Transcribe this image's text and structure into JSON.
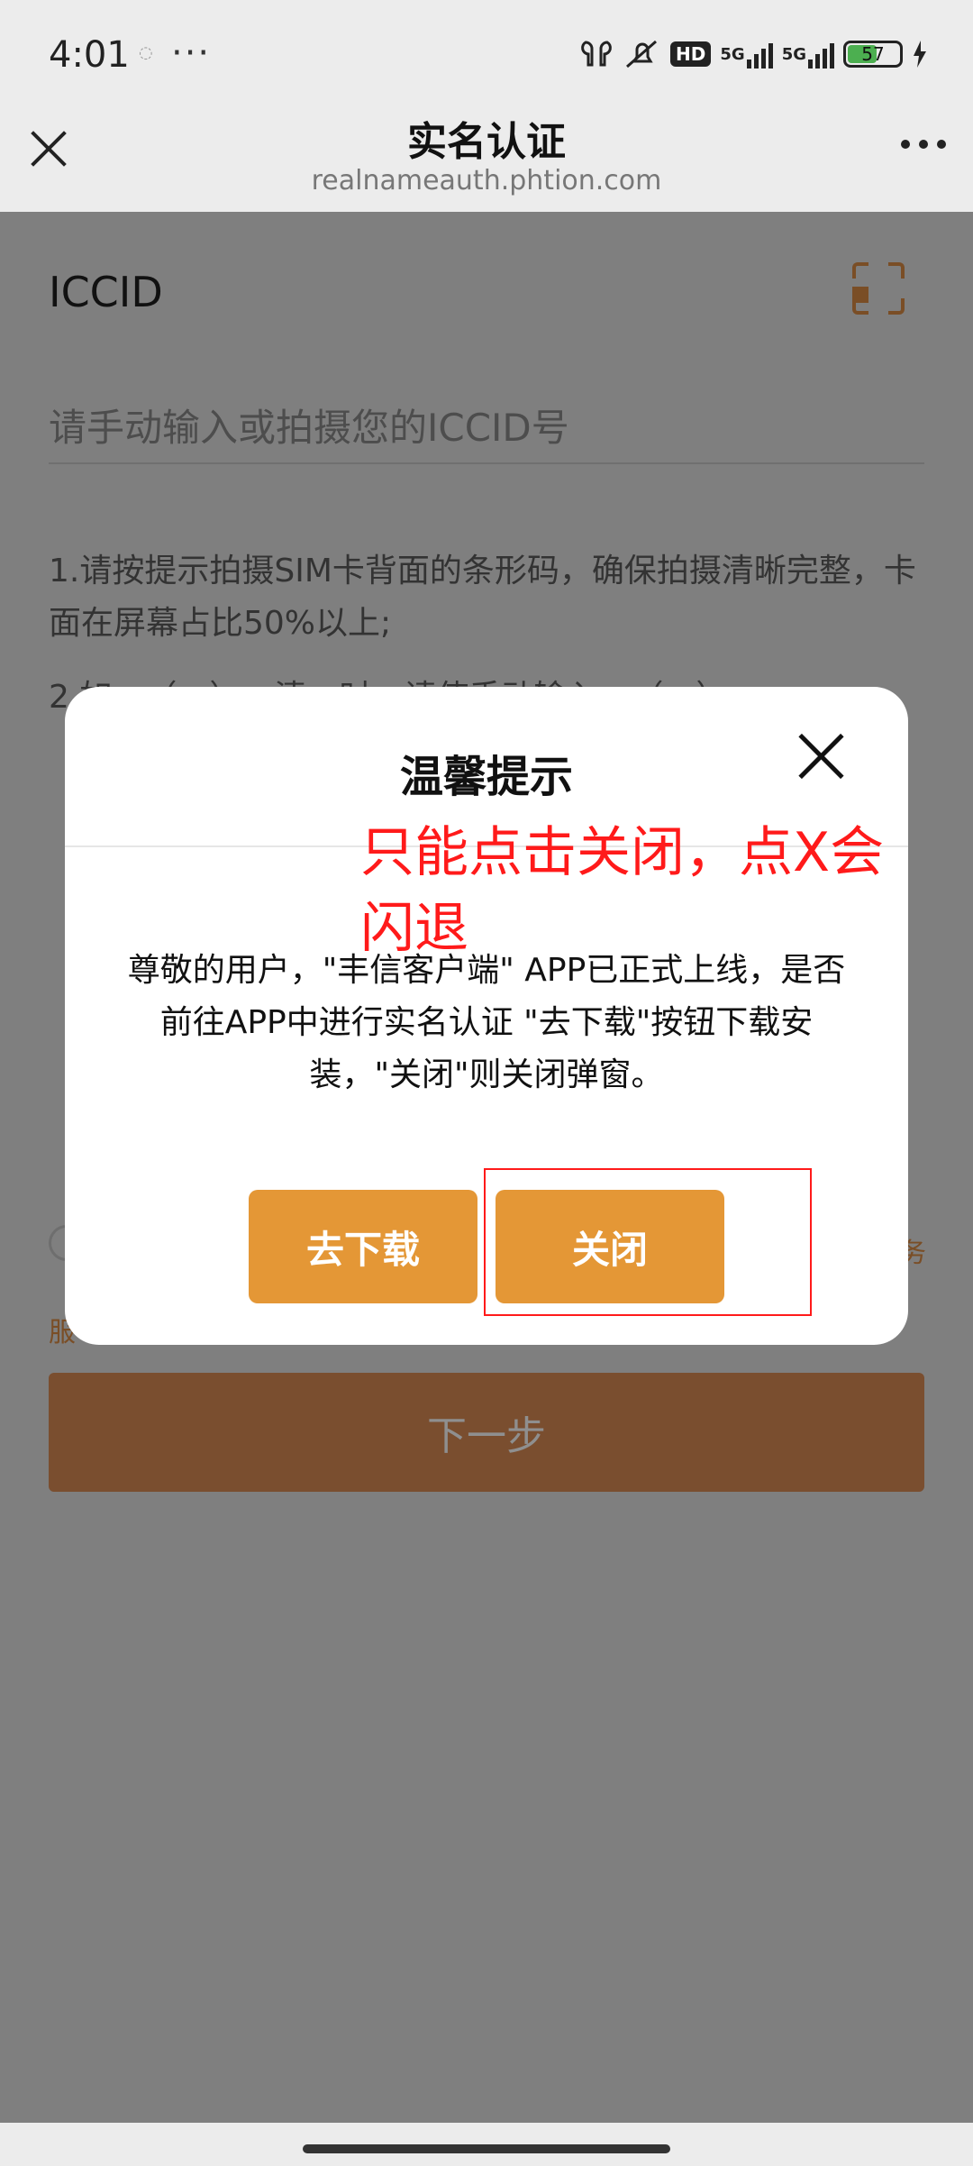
{
  "status_bar": {
    "time": "4:01",
    "dots": "···",
    "hd_label": "HD",
    "network_1": "5G",
    "network_2": "5G",
    "battery_level": "57",
    "battery_fraction": 0.57,
    "battery_color": "#4caf50"
  },
  "title_bar": {
    "title": "实名认证",
    "url": "realnameauth.phtion.com"
  },
  "form": {
    "label": "ICCID",
    "input_placeholder": "请手动输入或拍摄您的ICCID号",
    "input_value": "",
    "tip1": "1.请按提示拍摄SIM卡背面的条形码，确保拍摄清晰完整，卡面在屏幕占比50%以上;",
    "tip2": "2.如…（…）…清…时，请使手动输入…（…）",
    "agree_text_fragment": "服",
    "agree_text_right": "务",
    "next_button": "下一步"
  },
  "dialog": {
    "title": "温馨提示",
    "message": "尊敬的用户，\"丰信客户端\" APP已正式上线，是否前往APP中进行实名认证 \"去下载\"按钮下载安装，\"关闭\"则关闭弹窗。",
    "download_button": "去下载",
    "close_button": "关闭"
  },
  "annotation": {
    "text": "只能点击关闭，点X会闪退",
    "color": "#ff1a1a"
  },
  "colors": {
    "accent": "#e49736",
    "next_button_bg": "#7a4e2f",
    "overlay": "#7f7f7f"
  },
  "icons": {
    "close": "close-icon",
    "more": "more-dots-icon",
    "scan": "scan-icon",
    "dialog_close": "close-icon"
  }
}
